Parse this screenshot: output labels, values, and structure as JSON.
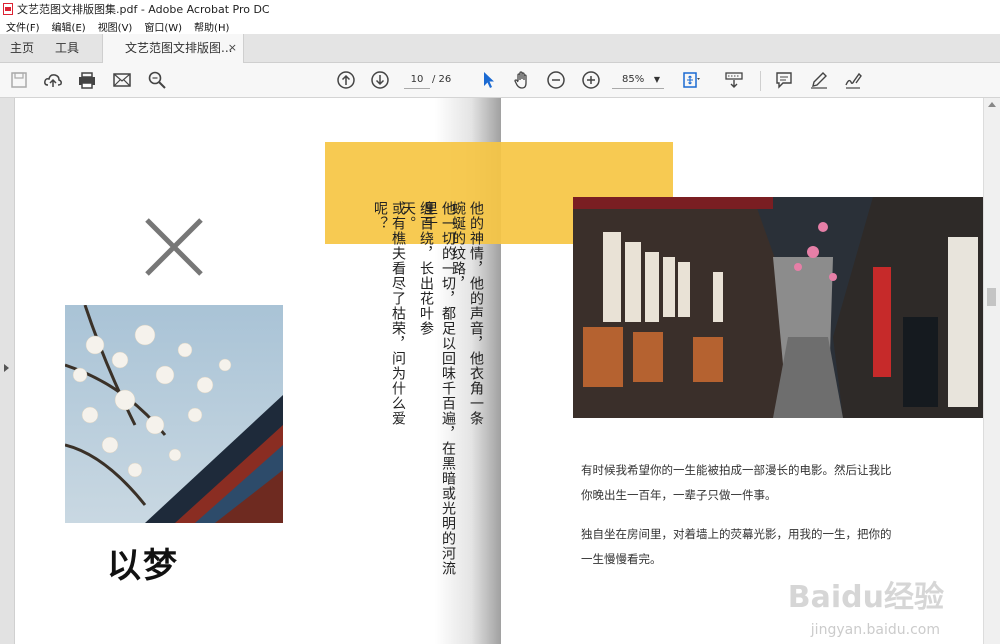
{
  "window": {
    "title": "文艺范图文排版图集.pdf - Adobe Acrobat Pro DC"
  },
  "menu": [
    "文件(F)",
    "编辑(E)",
    "视图(V)",
    "窗口(W)",
    "帮助(H)"
  ],
  "tabs": {
    "home": "主页",
    "tools": "工具",
    "document": "文艺范图文排版图...",
    "close": "×"
  },
  "toolbar": {
    "page_current": "10",
    "page_total": "/ 26",
    "zoom": "85%"
  },
  "document": {
    "heading": "以梦",
    "vertical_columns": [
      "他的神情，他的声音，他衣角一条蜿蜒的纹路，",
      "他一切的一切，都足以回味千百遍，在黑暗或光明的河流里千",
      "缠百绕，长出花叶参天。",
      "或有樵夫看尽了枯荣，问为什么爱呢？"
    ],
    "para1_line1": "有时候我希望你的一生能被拍成一部漫长的电影。然后让我比",
    "para1_line2": "你晚出生一百年，一辈子只做一件事。",
    "para2_line1": "独自坐在房间里，对着墙上的荧幕光影，用我的一生，把你的",
    "para2_line2": "一生慢慢看完。"
  },
  "watermark": {
    "brand": "Baidu经验",
    "url": "jingyan.baidu.com"
  },
  "colors": {
    "accent_yellow": "#f6c543",
    "page": "#ffffff",
    "toolbar": "#f7f7f7"
  }
}
